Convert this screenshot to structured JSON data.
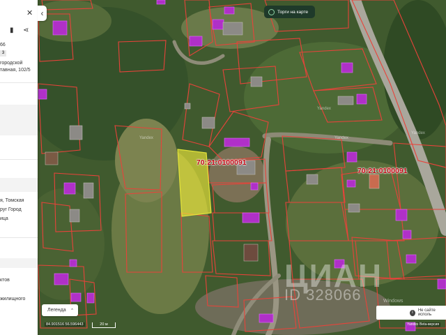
{
  "side_panel": {
    "lines": [
      "66",
      "городской",
      "тавная, 102/5",
      "я, Томская",
      "руг Город",
      "ица",
      "ктов",
      "жилищного"
    ],
    "badge": "3"
  },
  "map": {
    "auction_toggle_label": "Торги на карте",
    "cadastral_labels": [
      "70:21:0100091",
      "70:21:0100091"
    ],
    "yandex_labels": [
      "Yandex",
      "Yandex",
      "Yandex",
      "Yandex"
    ],
    "legend_label": "Легенда",
    "coordinates": "84.901516   56.596443",
    "scale_label": "20 м",
    "yandex_logo": "Yandex",
    "beta_label": "Beta-версия",
    "notice_text": "Не сайте исполь",
    "watermark": "ЦИАН",
    "watermark_id": "ID 328066",
    "os_watermark": "Windows",
    "colors": {
      "highlight_fill": "#f5ef3a",
      "parcel_border": "#e8433a",
      "building_marker": "#b030c8"
    }
  }
}
